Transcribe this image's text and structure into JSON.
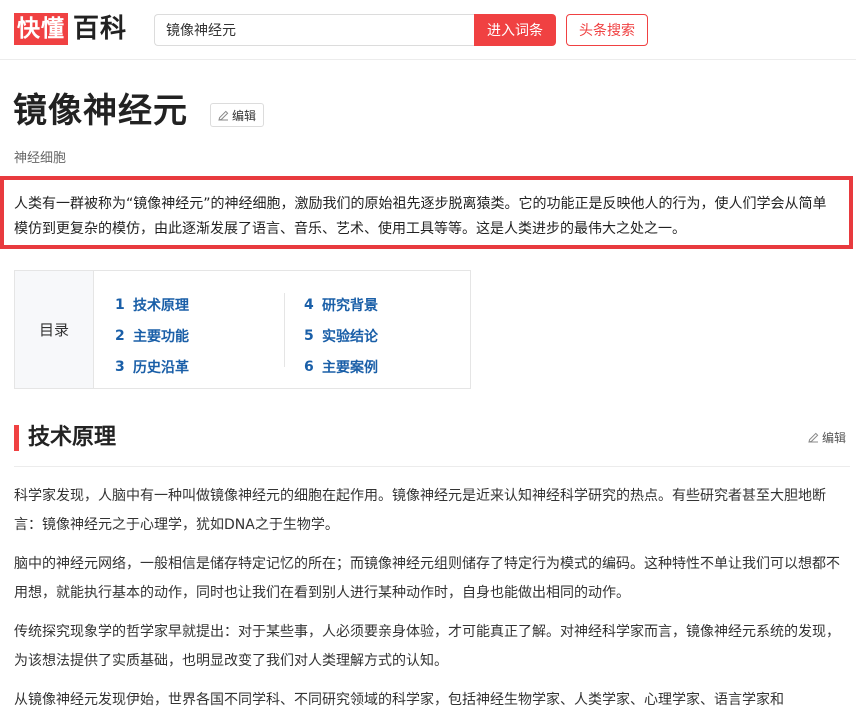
{
  "header": {
    "logo_red": "快懂",
    "logo_black": "百科",
    "search_value": "镜像神经元",
    "search_button": "进入词条",
    "toutiao_button": "头条搜索"
  },
  "article": {
    "title": "镜像神经元",
    "edit_label": "编辑",
    "subtitle": "神经细胞",
    "summary": "人类有一群被称为“镜像神经元”的神经细胞，激励我们的原始祖先逐步脱离猿类。它的功能正是反映他人的行为，使人们学会从简单模仿到更复杂的模仿，由此逐渐发展了语言、音乐、艺术、使用工具等等。这是人类进步的最伟大之处之一。"
  },
  "toc": {
    "label": "目录",
    "items": [
      {
        "num": "1",
        "label": "技术原理"
      },
      {
        "num": "2",
        "label": "主要功能"
      },
      {
        "num": "3",
        "label": "历史沿革"
      },
      {
        "num": "4",
        "label": "研究背景"
      },
      {
        "num": "5",
        "label": "实验结论"
      },
      {
        "num": "6",
        "label": "主要案例"
      }
    ]
  },
  "section": {
    "title": "技术原理",
    "edit_label": "编辑",
    "paragraphs": [
      "科学家发现，人脑中有一种叫做镜像神经元的细胞在起作用。镜像神经元是近来认知神经科学研究的热点。有些研究者甚至大胆地断言：镜像神经元之于心理学，犹如DNA之于生物学。",
      "脑中的神经元网络，一般相信是储存特定记忆的所在；而镜像神经元组则储存了特定行为模式的编码。这种特性不单让我们可以想都不用想，就能执行基本的动作，同时也让我们在看到别人进行某种动作时，自身也能做出相同的动作。",
      "传统探究现象学的哲学家早就提出：对于某些事，人必须要亲身体验，才可能真正了解。对神经科学家而言，镜像神经元系统的发现，为该想法提供了实质基础，也明显改变了我们对人类理解方式的认知。",
      "从镜像神经元发现伊始，世界各国不同学科、不同研究领域的科学家，包括神经生物学家、人类学家、心理学家、语言学家和"
    ]
  },
  "colors": {
    "accent": "#f04142",
    "link": "#1a5fa8",
    "highlight_border": "#e83a3e"
  },
  "icons": {
    "edit": "pencil-icon"
  }
}
